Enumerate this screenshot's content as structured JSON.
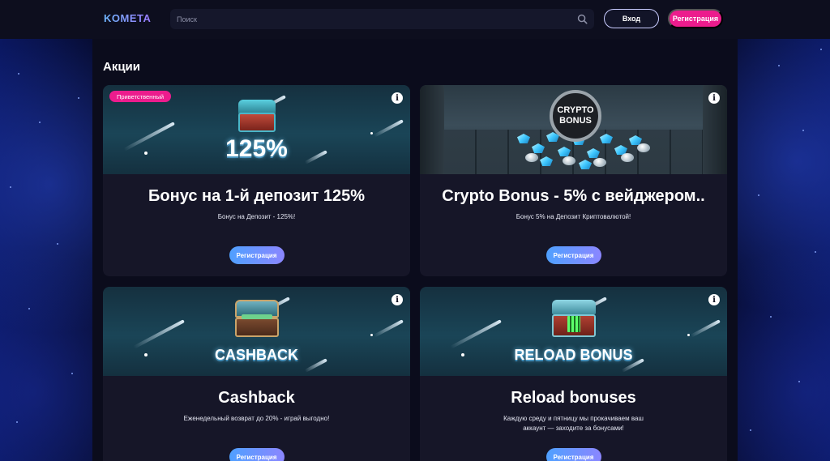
{
  "header": {
    "logo": "KOMETA",
    "search_placeholder": "Поиск",
    "login_label": "Вход",
    "register_label": "Регистрация"
  },
  "page": {
    "title": "Акции"
  },
  "cards": [
    {
      "badge": "Приветственный",
      "banner_text": "125%",
      "title": "Бонус на 1-й депозит 125%",
      "description": "Бонус на Депозит - 125%!",
      "button": "Регистрация"
    },
    {
      "banner_coin_line1": "CRYPTO",
      "banner_coin_line2": "BONUS",
      "title": "Crypto Bonus - 5% с вейджером..",
      "description": "Бонус 5% на Депозит Криптовалютой!",
      "button": "Регистрация"
    },
    {
      "banner_text": "CASHBACK",
      "title": "Cashback",
      "description": "Еженедельный возврат до 20% - играй выгодно!",
      "button": "Регистрация"
    },
    {
      "banner_text": "RELOAD BONUS",
      "title": "Reload bonuses",
      "description": "Каждую среду и пятницу мы прокачиваем ваш аккаунт — заходите за бонусами!",
      "button": "Регистрация"
    }
  ],
  "colors": {
    "accent_pink": "#ec1c8d",
    "button_gradient_start": "#4fa0ff",
    "button_gradient_end": "#8b86ff",
    "card_bg": "#161628",
    "page_bg": "#0b0c1c"
  },
  "icons": {
    "search": "search-icon",
    "info": "info-icon"
  }
}
